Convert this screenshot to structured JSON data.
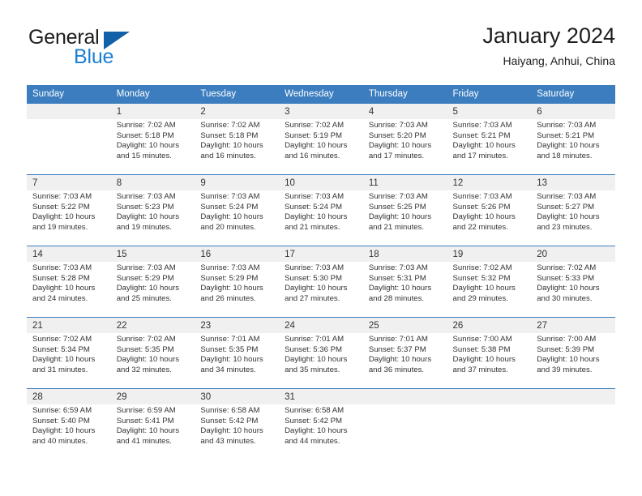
{
  "brand": {
    "name_part1": "General",
    "name_part2": "Blue",
    "accent_color": "#1b7fd4",
    "triangle_color": "#1161a8"
  },
  "header": {
    "title": "January 2024",
    "subtitle": "Haiyang, Anhui, China",
    "header_bg_color": "#3b7dbf"
  },
  "weekdays": [
    "Sunday",
    "Monday",
    "Tuesday",
    "Wednesday",
    "Thursday",
    "Friday",
    "Saturday"
  ],
  "weeks": [
    [
      {
        "day": "",
        "sunrise": "",
        "sunset": "",
        "daylight1": "",
        "daylight2": ""
      },
      {
        "day": "1",
        "sunrise": "Sunrise: 7:02 AM",
        "sunset": "Sunset: 5:18 PM",
        "daylight1": "Daylight: 10 hours",
        "daylight2": "and 15 minutes."
      },
      {
        "day": "2",
        "sunrise": "Sunrise: 7:02 AM",
        "sunset": "Sunset: 5:18 PM",
        "daylight1": "Daylight: 10 hours",
        "daylight2": "and 16 minutes."
      },
      {
        "day": "3",
        "sunrise": "Sunrise: 7:02 AM",
        "sunset": "Sunset: 5:19 PM",
        "daylight1": "Daylight: 10 hours",
        "daylight2": "and 16 minutes."
      },
      {
        "day": "4",
        "sunrise": "Sunrise: 7:03 AM",
        "sunset": "Sunset: 5:20 PM",
        "daylight1": "Daylight: 10 hours",
        "daylight2": "and 17 minutes."
      },
      {
        "day": "5",
        "sunrise": "Sunrise: 7:03 AM",
        "sunset": "Sunset: 5:21 PM",
        "daylight1": "Daylight: 10 hours",
        "daylight2": "and 17 minutes."
      },
      {
        "day": "6",
        "sunrise": "Sunrise: 7:03 AM",
        "sunset": "Sunset: 5:21 PM",
        "daylight1": "Daylight: 10 hours",
        "daylight2": "and 18 minutes."
      }
    ],
    [
      {
        "day": "7",
        "sunrise": "Sunrise: 7:03 AM",
        "sunset": "Sunset: 5:22 PM",
        "daylight1": "Daylight: 10 hours",
        "daylight2": "and 19 minutes."
      },
      {
        "day": "8",
        "sunrise": "Sunrise: 7:03 AM",
        "sunset": "Sunset: 5:23 PM",
        "daylight1": "Daylight: 10 hours",
        "daylight2": "and 19 minutes."
      },
      {
        "day": "9",
        "sunrise": "Sunrise: 7:03 AM",
        "sunset": "Sunset: 5:24 PM",
        "daylight1": "Daylight: 10 hours",
        "daylight2": "and 20 minutes."
      },
      {
        "day": "10",
        "sunrise": "Sunrise: 7:03 AM",
        "sunset": "Sunset: 5:24 PM",
        "daylight1": "Daylight: 10 hours",
        "daylight2": "and 21 minutes."
      },
      {
        "day": "11",
        "sunrise": "Sunrise: 7:03 AM",
        "sunset": "Sunset: 5:25 PM",
        "daylight1": "Daylight: 10 hours",
        "daylight2": "and 21 minutes."
      },
      {
        "day": "12",
        "sunrise": "Sunrise: 7:03 AM",
        "sunset": "Sunset: 5:26 PM",
        "daylight1": "Daylight: 10 hours",
        "daylight2": "and 22 minutes."
      },
      {
        "day": "13",
        "sunrise": "Sunrise: 7:03 AM",
        "sunset": "Sunset: 5:27 PM",
        "daylight1": "Daylight: 10 hours",
        "daylight2": "and 23 minutes."
      }
    ],
    [
      {
        "day": "14",
        "sunrise": "Sunrise: 7:03 AM",
        "sunset": "Sunset: 5:28 PM",
        "daylight1": "Daylight: 10 hours",
        "daylight2": "and 24 minutes."
      },
      {
        "day": "15",
        "sunrise": "Sunrise: 7:03 AM",
        "sunset": "Sunset: 5:29 PM",
        "daylight1": "Daylight: 10 hours",
        "daylight2": "and 25 minutes."
      },
      {
        "day": "16",
        "sunrise": "Sunrise: 7:03 AM",
        "sunset": "Sunset: 5:29 PM",
        "daylight1": "Daylight: 10 hours",
        "daylight2": "and 26 minutes."
      },
      {
        "day": "17",
        "sunrise": "Sunrise: 7:03 AM",
        "sunset": "Sunset: 5:30 PM",
        "daylight1": "Daylight: 10 hours",
        "daylight2": "and 27 minutes."
      },
      {
        "day": "18",
        "sunrise": "Sunrise: 7:03 AM",
        "sunset": "Sunset: 5:31 PM",
        "daylight1": "Daylight: 10 hours",
        "daylight2": "and 28 minutes."
      },
      {
        "day": "19",
        "sunrise": "Sunrise: 7:02 AM",
        "sunset": "Sunset: 5:32 PM",
        "daylight1": "Daylight: 10 hours",
        "daylight2": "and 29 minutes."
      },
      {
        "day": "20",
        "sunrise": "Sunrise: 7:02 AM",
        "sunset": "Sunset: 5:33 PM",
        "daylight1": "Daylight: 10 hours",
        "daylight2": "and 30 minutes."
      }
    ],
    [
      {
        "day": "21",
        "sunrise": "Sunrise: 7:02 AM",
        "sunset": "Sunset: 5:34 PM",
        "daylight1": "Daylight: 10 hours",
        "daylight2": "and 31 minutes."
      },
      {
        "day": "22",
        "sunrise": "Sunrise: 7:02 AM",
        "sunset": "Sunset: 5:35 PM",
        "daylight1": "Daylight: 10 hours",
        "daylight2": "and 32 minutes."
      },
      {
        "day": "23",
        "sunrise": "Sunrise: 7:01 AM",
        "sunset": "Sunset: 5:35 PM",
        "daylight1": "Daylight: 10 hours",
        "daylight2": "and 34 minutes."
      },
      {
        "day": "24",
        "sunrise": "Sunrise: 7:01 AM",
        "sunset": "Sunset: 5:36 PM",
        "daylight1": "Daylight: 10 hours",
        "daylight2": "and 35 minutes."
      },
      {
        "day": "25",
        "sunrise": "Sunrise: 7:01 AM",
        "sunset": "Sunset: 5:37 PM",
        "daylight1": "Daylight: 10 hours",
        "daylight2": "and 36 minutes."
      },
      {
        "day": "26",
        "sunrise": "Sunrise: 7:00 AM",
        "sunset": "Sunset: 5:38 PM",
        "daylight1": "Daylight: 10 hours",
        "daylight2": "and 37 minutes."
      },
      {
        "day": "27",
        "sunrise": "Sunrise: 7:00 AM",
        "sunset": "Sunset: 5:39 PM",
        "daylight1": "Daylight: 10 hours",
        "daylight2": "and 39 minutes."
      }
    ],
    [
      {
        "day": "28",
        "sunrise": "Sunrise: 6:59 AM",
        "sunset": "Sunset: 5:40 PM",
        "daylight1": "Daylight: 10 hours",
        "daylight2": "and 40 minutes."
      },
      {
        "day": "29",
        "sunrise": "Sunrise: 6:59 AM",
        "sunset": "Sunset: 5:41 PM",
        "daylight1": "Daylight: 10 hours",
        "daylight2": "and 41 minutes."
      },
      {
        "day": "30",
        "sunrise": "Sunrise: 6:58 AM",
        "sunset": "Sunset: 5:42 PM",
        "daylight1": "Daylight: 10 hours",
        "daylight2": "and 43 minutes."
      },
      {
        "day": "31",
        "sunrise": "Sunrise: 6:58 AM",
        "sunset": "Sunset: 5:42 PM",
        "daylight1": "Daylight: 10 hours",
        "daylight2": "and 44 minutes."
      },
      {
        "day": "",
        "sunrise": "",
        "sunset": "",
        "daylight1": "",
        "daylight2": ""
      },
      {
        "day": "",
        "sunrise": "",
        "sunset": "",
        "daylight1": "",
        "daylight2": ""
      },
      {
        "day": "",
        "sunrise": "",
        "sunset": "",
        "daylight1": "",
        "daylight2": ""
      }
    ]
  ]
}
